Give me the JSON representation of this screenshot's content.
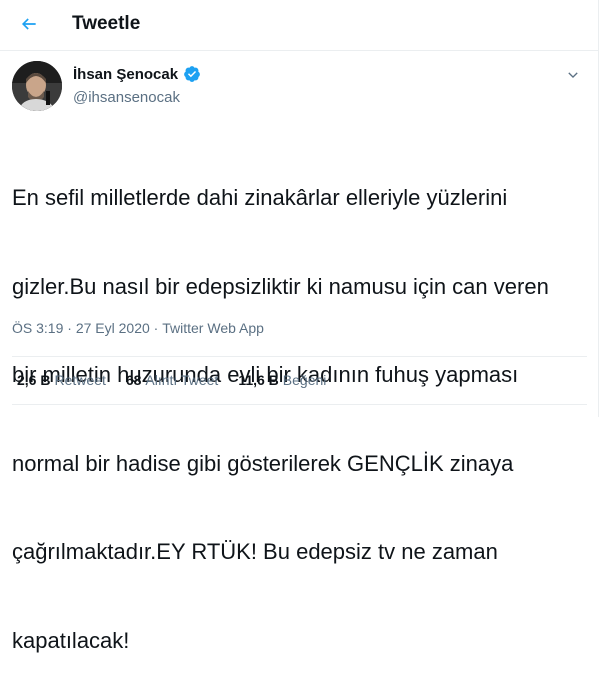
{
  "header": {
    "title": "Tweetle",
    "back_icon": "arrow-left-icon"
  },
  "colors": {
    "accent": "#1da1f2",
    "text": "#0f1419",
    "secondary": "#5b7083",
    "border": "#ebeef0"
  },
  "tweet": {
    "author": {
      "display_name": "İhsan Şenocak",
      "handle": "@ihsansenocak",
      "verified": true,
      "verified_icon": "verified-badge-icon"
    },
    "menu_icon": "chevron-down-icon",
    "text_lines": [
      "En sefil milletlerde dahi zinakârlar elleriyle yüzlerini",
      "gizler.Bu nasıl bir edepsizliktir ki namusu için can veren",
      "bir milletin huzurunda evli bir kadının fuhuş yapması",
      "normal bir hadise gibi gösterilerek GENÇLİK zinaya",
      "çağrılmaktadır.EY RTÜK! Bu edepsiz tv ne zaman",
      "kapatılacak!"
    ],
    "time": "ÖS 3:19",
    "separator": " · ",
    "date": "27 Eyl 2020",
    "source": "Twitter Web App"
  },
  "stats": [
    {
      "count": "2,6 B",
      "label": "Retweet"
    },
    {
      "count": "68",
      "label": "Alıntı Tweet"
    },
    {
      "count": "11,6 B",
      "label": "Beğeni"
    }
  ]
}
